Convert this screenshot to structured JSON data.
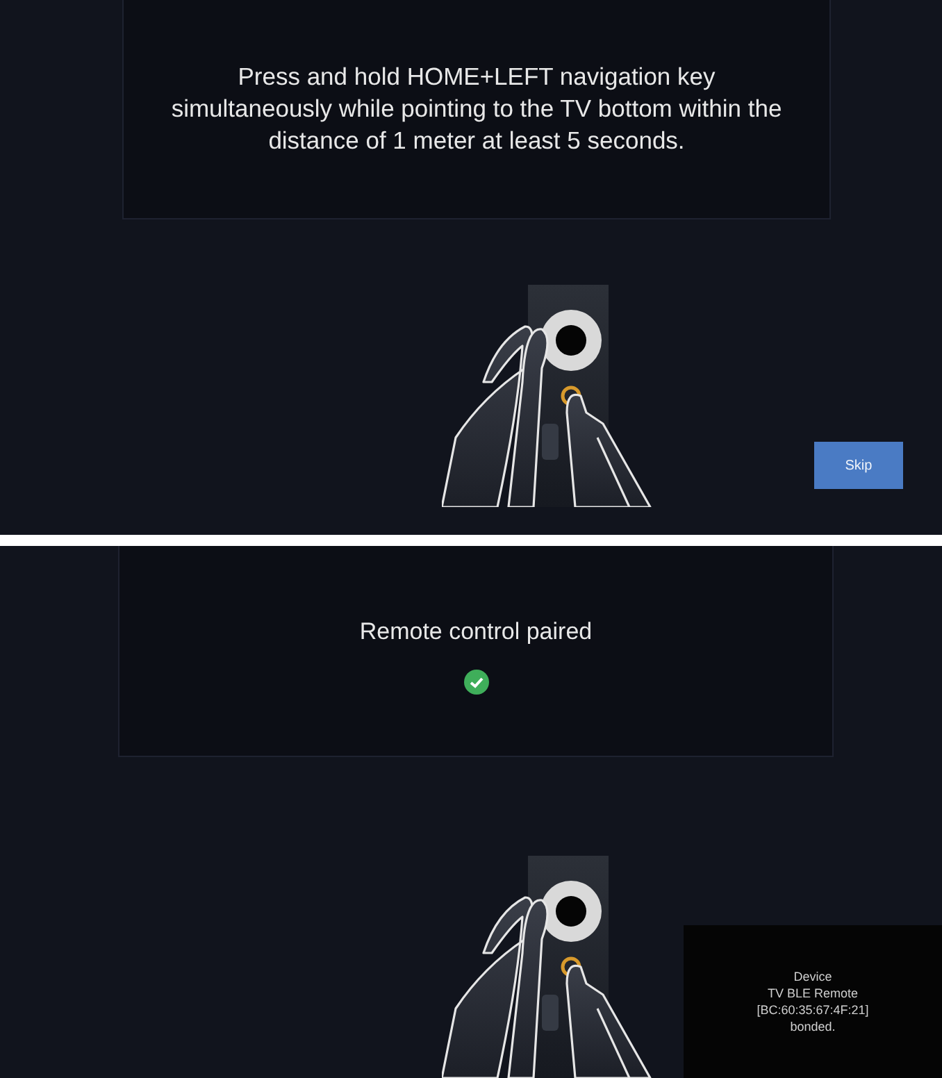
{
  "screens": [
    {
      "kind": "instruction",
      "message": "Press and hold HOME+LEFT navigation key simultaneously while pointing to the TV bottom within the distance of 1 meter at least 5 seconds.",
      "skip_button": "Skip"
    },
    {
      "kind": "paired",
      "message": "Remote control paired",
      "toast": [
        "Device",
        "TV BLE Remote",
        "[BC:60:35:67:4F:21]",
        "bonded."
      ]
    }
  ]
}
